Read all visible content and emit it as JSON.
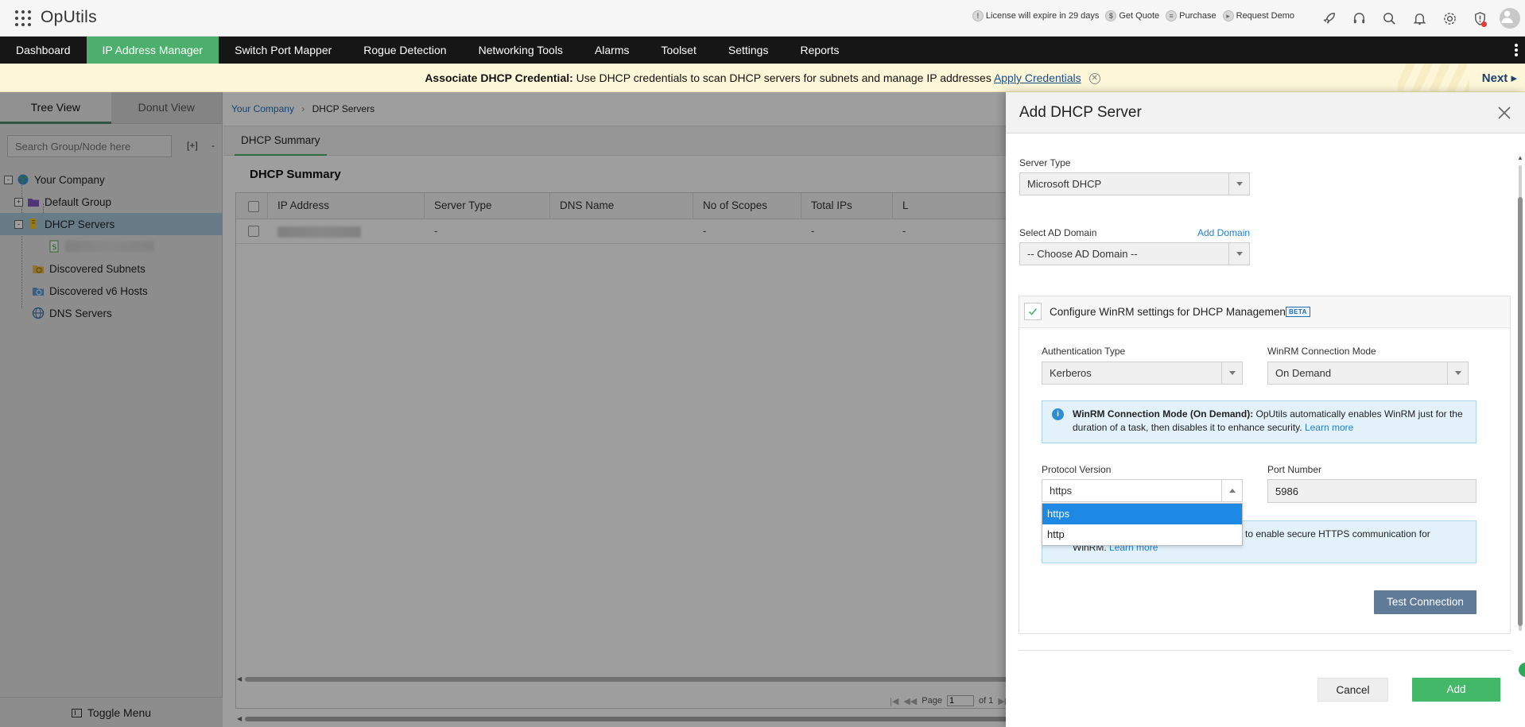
{
  "app": {
    "title": "OpUtils"
  },
  "top_links": [
    {
      "label": "License will expire in 29 days",
      "icon": "license-icon"
    },
    {
      "label": "Get Quote",
      "icon": "dollar-icon"
    },
    {
      "label": "Purchase",
      "icon": "cart-icon"
    },
    {
      "label": "Request Demo",
      "icon": "demo-icon"
    }
  ],
  "nav": {
    "items": [
      "Dashboard",
      "IP Address Manager",
      "Switch Port Mapper",
      "Rogue Detection",
      "Networking Tools",
      "Alarms",
      "Toolset",
      "Settings",
      "Reports"
    ],
    "active": "IP Address Manager",
    "active_color": "#4caf6d"
  },
  "banner": {
    "bold": "Associate DHCP Credential:",
    "text": " Use DHCP credentials to scan DHCP servers for subnets and manage IP addresses ",
    "link": "Apply Credentials",
    "next": "Next"
  },
  "sidebar": {
    "tabs": [
      "Tree View",
      "Donut View"
    ],
    "search_placeholder": "Search Group/Node here",
    "expand": "[+]",
    "collapse": "-",
    "tree": [
      "Your Company",
      "Default Group",
      "DHCP Servers",
      "Discovered Subnets",
      "Discovered v6 Hosts",
      "DNS Servers"
    ],
    "toggle_menu": "Toggle Menu"
  },
  "main": {
    "breadcrumb": {
      "root": "Your Company",
      "current": "DHCP Servers"
    },
    "tab": "DHCP Summary",
    "section_title": "DHCP Summary",
    "columns": [
      "IP Address",
      "Server Type",
      "DNS Name",
      "No of Scopes",
      "Total IPs",
      "L"
    ],
    "rows": [
      {
        "server_type": "-",
        "dns_name": "",
        "scopes": "-",
        "total_ips": "-",
        "l": "-"
      }
    ],
    "pager": {
      "page_label": "Page",
      "page_value": "1",
      "of_label": "of 1"
    }
  },
  "drawer": {
    "title": "Add DHCP Server",
    "server_type": {
      "label": "Server Type",
      "value": "Microsoft DHCP"
    },
    "ad_domain": {
      "label": "Select AD Domain",
      "value": "-- Choose AD Domain --",
      "add_link": "Add Domain"
    },
    "winrm": {
      "title": "Configure WinRM settings for DHCP Management",
      "badge": "BETA",
      "checked": true,
      "auth_type": {
        "label": "Authentication Type",
        "value": "Kerberos"
      },
      "conn_mode": {
        "label": "WinRM Connection Mode",
        "value": "On Demand"
      },
      "info1": {
        "bold": "WinRM Connection Mode (On Demand):",
        "text": " OpUtils automatically enables WinRM just for the duration of a task, then disables it to enhance security. ",
        "link": "Learn more"
      },
      "protocol": {
        "label": "Protocol Version",
        "value": "https",
        "options": [
          "https",
          "http"
        ],
        "highlighted": "https"
      },
      "port": {
        "label": "Port Number",
        "value": "5986"
      },
      "info2": {
        "text": "ficate to enable secure HTTPS communication for",
        "text2": "WinRM.",
        "link": "Learn more"
      },
      "test_button": "Test Connection"
    },
    "cancel": "Cancel",
    "add": "Add",
    "add_color": "#43b868"
  }
}
